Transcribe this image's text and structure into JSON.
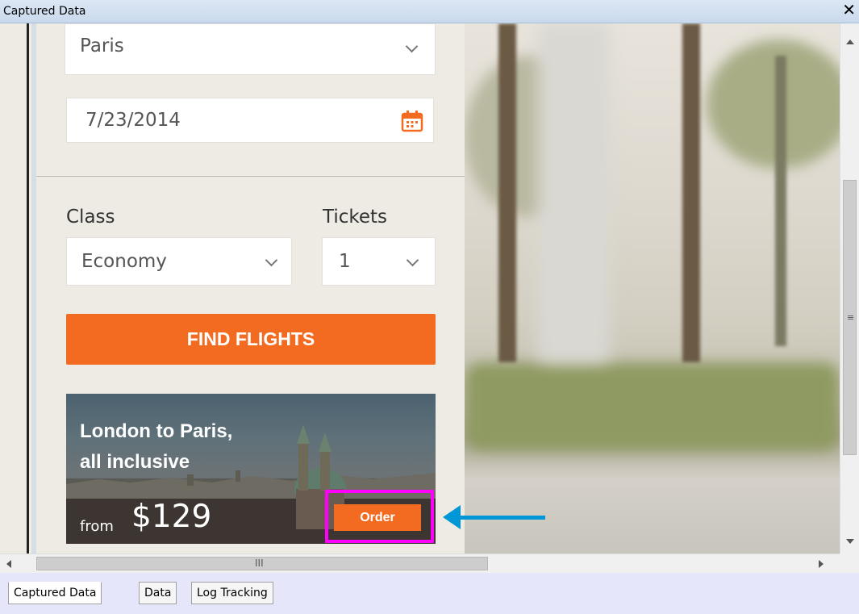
{
  "window": {
    "title": "Captured Data",
    "close_glyph": "✕"
  },
  "form": {
    "destination": "Paris",
    "date": "7/23/2014",
    "class_label": "Class",
    "class_value": "Economy",
    "tickets_label": "Tickets",
    "tickets_value": "1",
    "find_button": "FIND FLIGHTS"
  },
  "promo": {
    "headline_line1": "London to Paris,",
    "headline_line2": "all inclusive",
    "from": "from",
    "price": "$129",
    "order_button": "Order"
  },
  "annotation": {
    "highlight_color": "#ff00ff",
    "arrow_color": "#0097d6"
  },
  "colors": {
    "accent": "#f26b21"
  },
  "scrollbars": {
    "v_grip": "≡",
    "h_grip": "III"
  },
  "tabs": [
    {
      "label": "Captured Data",
      "active": true
    },
    {
      "label": "Data",
      "active": false
    },
    {
      "label": "Log Tracking",
      "active": false
    }
  ]
}
